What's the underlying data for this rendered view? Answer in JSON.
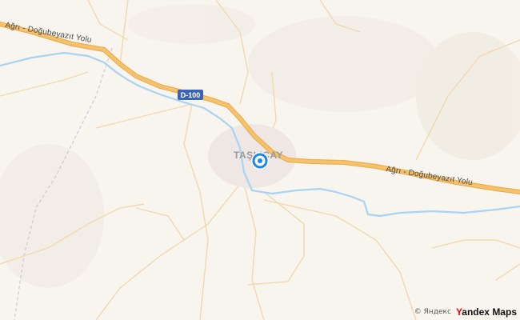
{
  "map": {
    "road_label_nw": "Ağrı - Doğubeyazıt Yolu",
    "road_label_e": "Ağrı - Doğubeyazıt Yolu",
    "route_shield": "D-100",
    "town_label": "TAŞLIÇAY",
    "colors": {
      "background": "#f8f4ee",
      "highway": "#f5c16a",
      "highway_casing": "#e9a94a",
      "minor_road": "#f0d9b0",
      "river": "#a9d3f2",
      "boundary": "#c8c8d8",
      "shield": "#3b63b1",
      "location_marker": "#1e88e5"
    },
    "location_marker_icon": "current-location-icon"
  },
  "attribution": {
    "copyright": "© Яндекс",
    "brand_first_letter": "Y",
    "brand_rest": "andex Maps"
  }
}
